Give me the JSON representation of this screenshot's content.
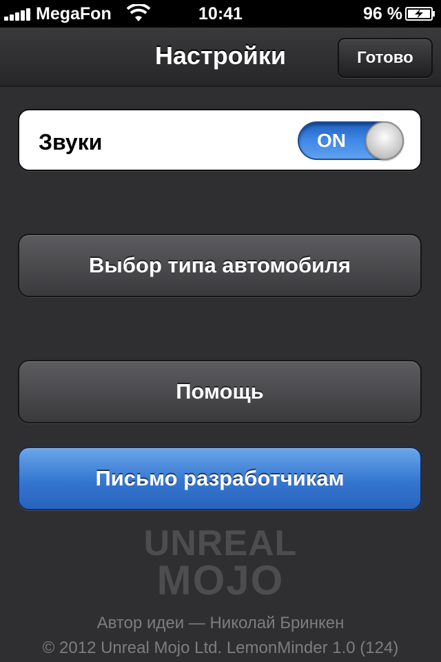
{
  "status_bar": {
    "carrier": "MegaFon",
    "time": "10:41",
    "battery_percent": "96 %"
  },
  "nav": {
    "title": "Настройки",
    "done_label": "Готово"
  },
  "settings": {
    "sound_label": "Звуки",
    "sound_toggle": "ON"
  },
  "buttons": {
    "car_type": "Выбор типа автомобиля",
    "help": "Помощь",
    "mail_devs": "Письмо разработчикам"
  },
  "logo": {
    "line1": "UNREAL",
    "line2": "MOJO"
  },
  "footer": {
    "author": "Автор идеи — Николай Бринкен",
    "copyright": "© 2012 Unreal Mojo Ltd. LemonMinder 1.0 (124)"
  },
  "colors": {
    "background": "#2f2f31",
    "accent_blue": "#3576d0",
    "toggle_blue": "#3d86e6"
  }
}
